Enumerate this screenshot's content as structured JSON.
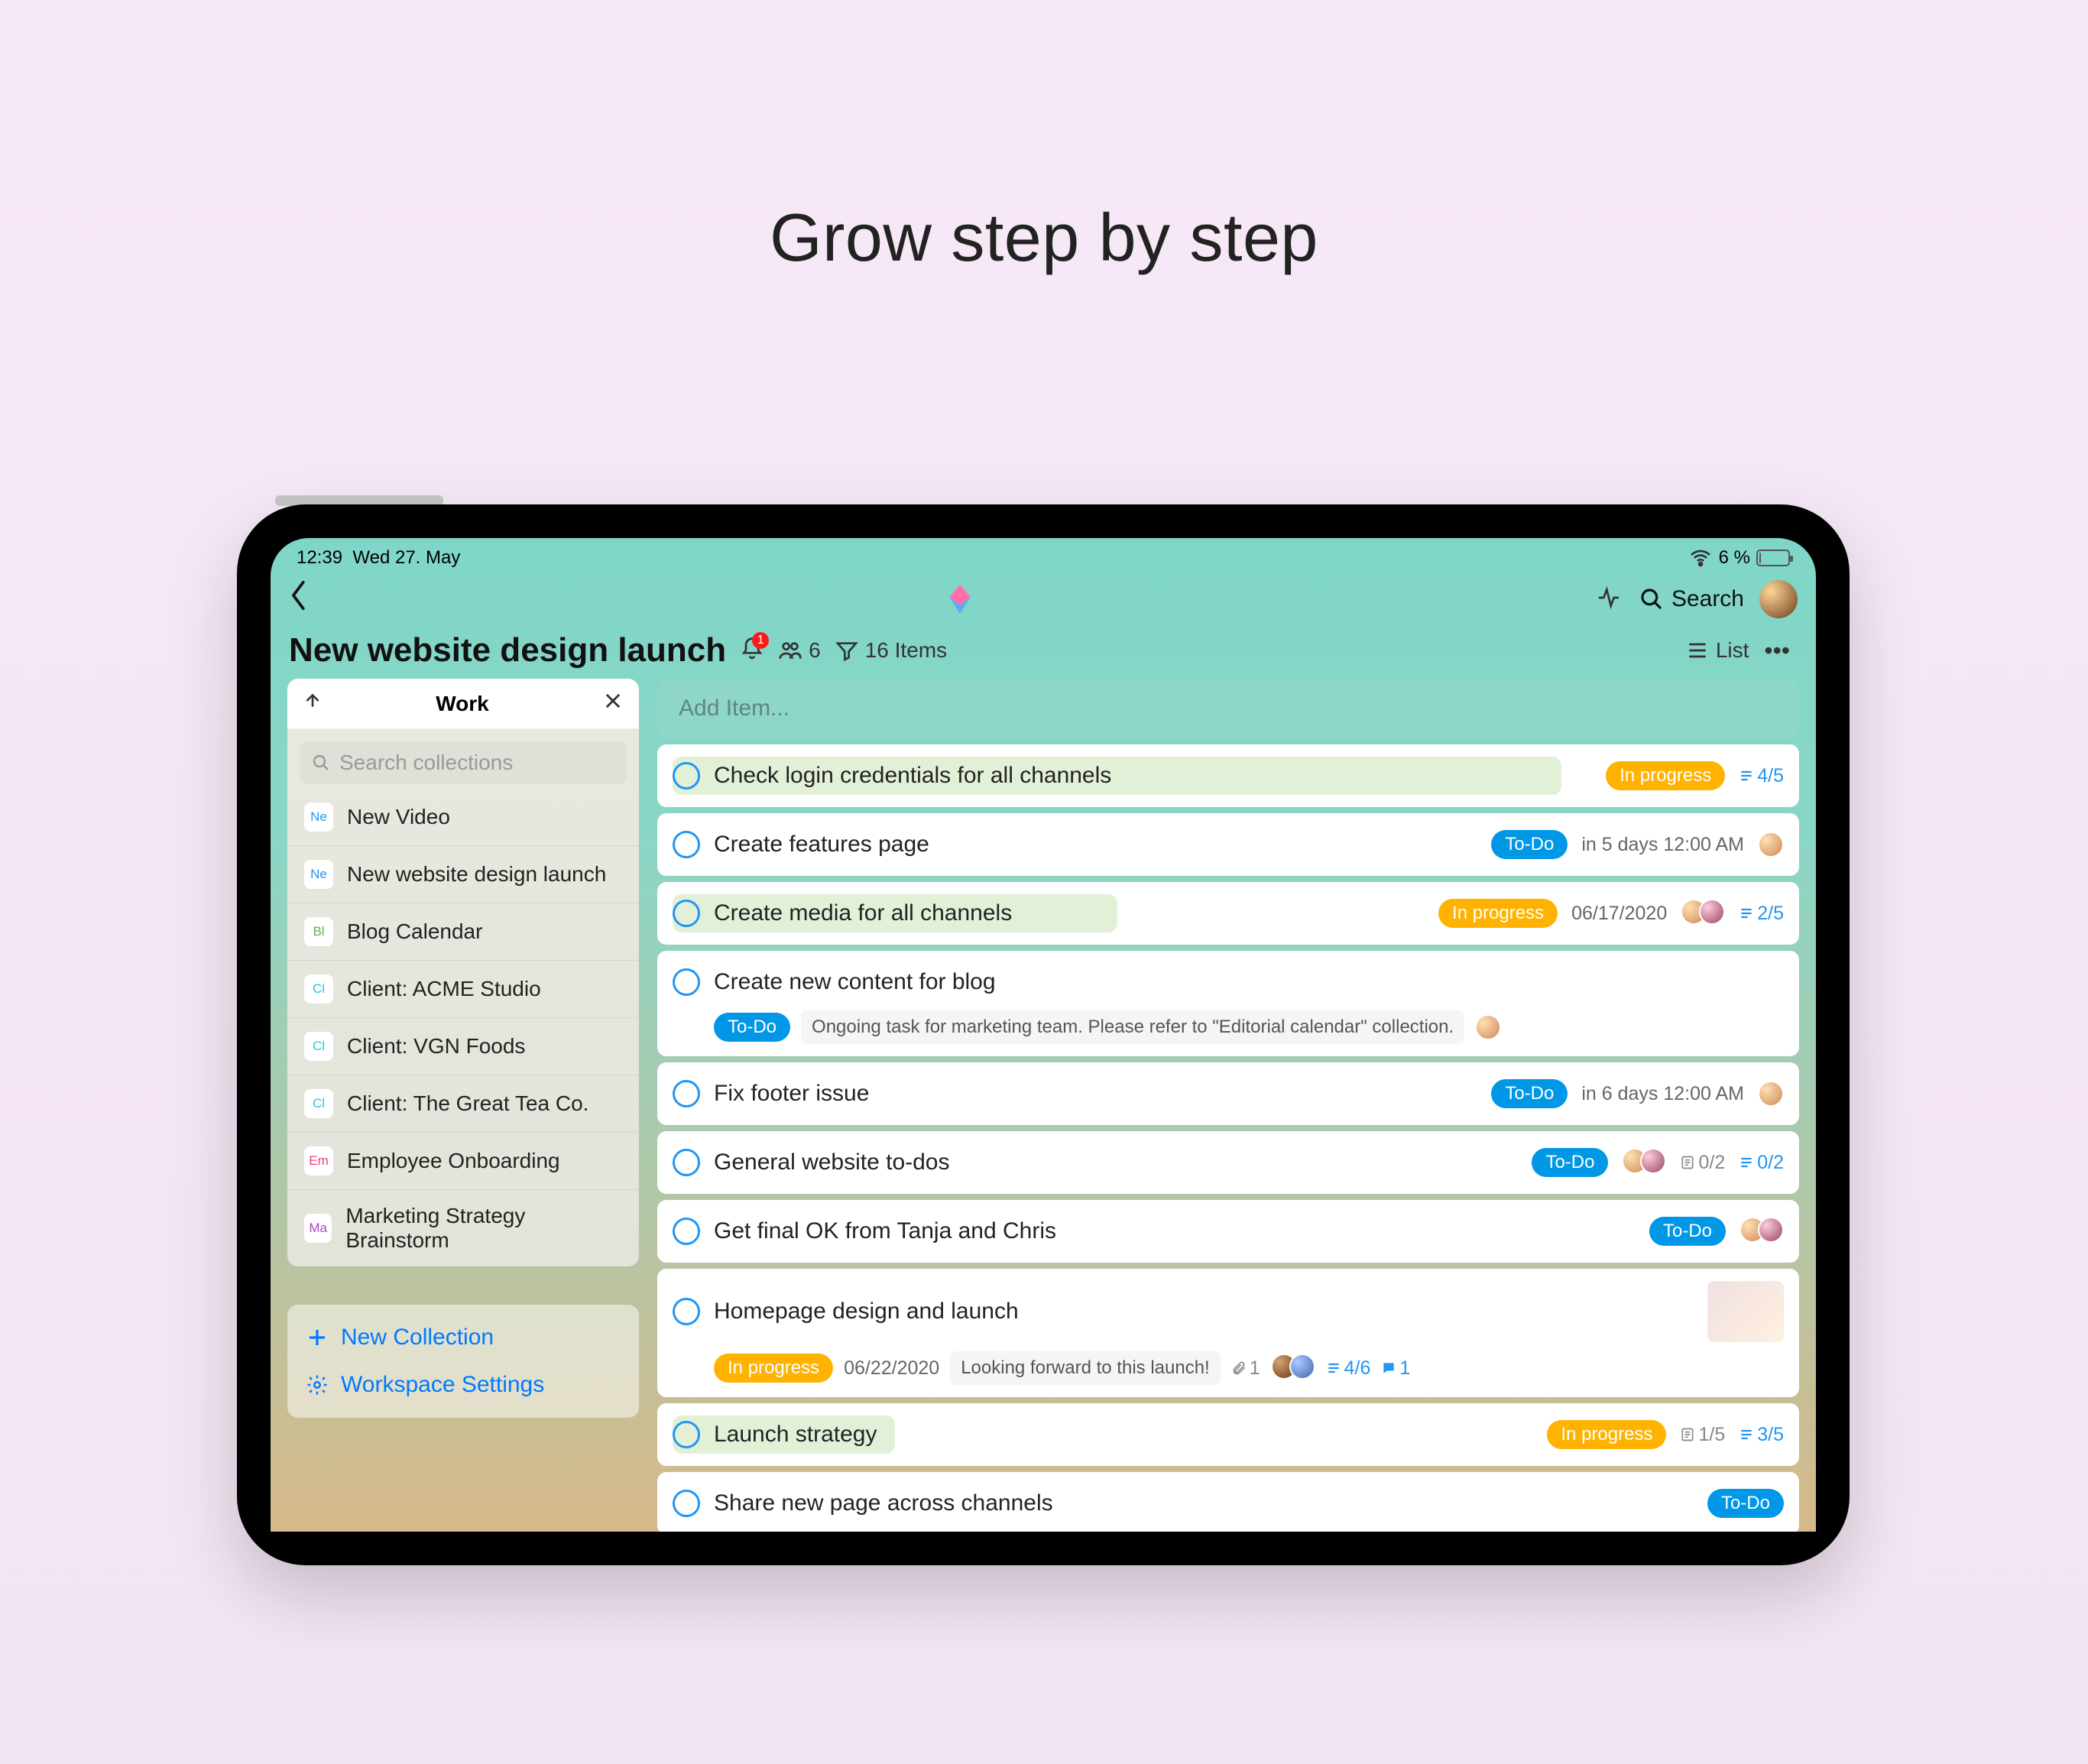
{
  "hero": {
    "title": "Grow step by step"
  },
  "status": {
    "time": "12:39",
    "date": "Wed 27. May",
    "battery": "6 %"
  },
  "nav": {
    "search_label": "Search"
  },
  "page": {
    "title": "New website design launch",
    "notification_badge": "1",
    "members": "6",
    "item_count": "16 Items",
    "view_mode": "List"
  },
  "sidebar": {
    "header": "Work",
    "search_placeholder": "Search collections",
    "items": [
      {
        "tag": "Ne",
        "tag_color": "#2196f3",
        "label": "New Video"
      },
      {
        "tag": "Ne",
        "tag_color": "#2196f3",
        "label": "New website design launch"
      },
      {
        "tag": "Bl",
        "tag_color": "#6aa84f",
        "label": "Blog Calendar"
      },
      {
        "tag": "Cl",
        "tag_color": "#26c6da",
        "label": "Client: ACME Studio"
      },
      {
        "tag": "Cl",
        "tag_color": "#26c6da",
        "label": "Client: VGN Foods"
      },
      {
        "tag": "Cl",
        "tag_color": "#26c6da",
        "label": "Client: The Great Tea Co."
      },
      {
        "tag": "Em",
        "tag_color": "#ec407a",
        "label": "Employee Onboarding"
      },
      {
        "tag": "Ma",
        "tag_color": "#ab47bc",
        "label": "Marketing Strategy Brainstorm"
      }
    ],
    "new_collection": "New Collection",
    "workspace_settings": "Workspace Settings"
  },
  "add_item_placeholder": "Add Item...",
  "tasks": [
    {
      "title": "Check login credentials for all channels",
      "status": "In progress",
      "status_type": "progress",
      "progress_pct": 80,
      "right": [
        {
          "kind": "sub",
          "text": "4/5"
        }
      ]
    },
    {
      "title": "Create features page",
      "status": "To-Do",
      "status_type": "todo",
      "right": [
        {
          "kind": "text",
          "text": "in 5 days 12:00 AM"
        },
        {
          "kind": "avatar"
        }
      ]
    },
    {
      "title": "Create media for all channels",
      "status": "In progress",
      "status_type": "progress",
      "progress_pct": 40,
      "right": [
        {
          "kind": "text",
          "text": "06/17/2020"
        },
        {
          "kind": "avatars2"
        },
        {
          "kind": "sub",
          "text": "2/5"
        }
      ]
    },
    {
      "title": "Create new content for blog",
      "status": "To-Do",
      "status_type": "todo",
      "sub_note": "Ongoing task for marketing team. Please refer to \"Editorial calendar\" collection.",
      "sub_has_avatar": true
    },
    {
      "title": "Fix footer issue",
      "status": "To-Do",
      "status_type": "todo",
      "right": [
        {
          "kind": "text",
          "text": "in 6 days 12:00 AM"
        },
        {
          "kind": "avatar"
        }
      ]
    },
    {
      "title": "General website to-dos",
      "status": "To-Do",
      "status_type": "todo",
      "right": [
        {
          "kind": "avatars2"
        },
        {
          "kind": "note",
          "text": "0/2"
        },
        {
          "kind": "sub",
          "text": "0/2"
        }
      ]
    },
    {
      "title": "Get final OK from Tanja and Chris",
      "status": "To-Do",
      "status_type": "todo",
      "right": [
        {
          "kind": "avatars2"
        }
      ]
    },
    {
      "title": "Homepage design and launch",
      "status": "In progress",
      "status_type": "progress",
      "sub_row": {
        "date": "06/22/2020",
        "note": "Looking forward to this launch!",
        "attach": "1",
        "subtasks": "4/6",
        "comments": "1"
      },
      "has_thumb": true
    },
    {
      "title": "Launch strategy",
      "status": "In progress",
      "status_type": "progress",
      "progress_pct": 20,
      "right": [
        {
          "kind": "note",
          "text": "1/5"
        },
        {
          "kind": "sub",
          "text": "3/5"
        }
      ]
    },
    {
      "title": "Share new page across channels",
      "status": "To-Do",
      "status_type": "todo"
    }
  ]
}
